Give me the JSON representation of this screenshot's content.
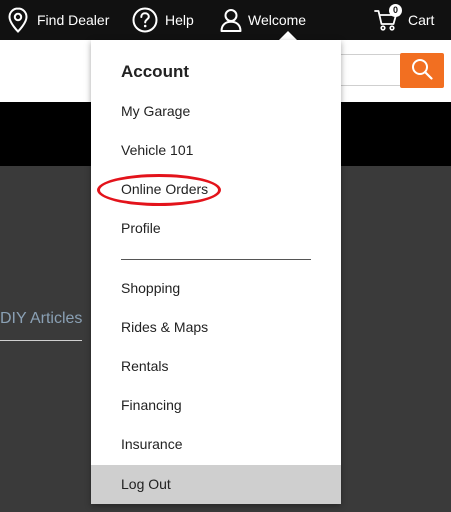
{
  "topbar": {
    "find_dealer": "Find Dealer",
    "help": "Help",
    "welcome": "Welcome",
    "cart": "Cart",
    "cart_count": "0"
  },
  "search": {
    "value": "",
    "placeholder": ""
  },
  "page": {
    "diy_articles": "DIY Articles"
  },
  "account_menu": {
    "title": "Account",
    "items_top": [
      "My Garage",
      "Vehicle 101",
      "Online Orders",
      "Profile"
    ],
    "items_bottom": [
      "Shopping",
      "Rides & Maps",
      "Rentals",
      "Financing",
      "Insurance"
    ],
    "logout": "Log Out",
    "highlighted_item": "Online Orders"
  },
  "colors": {
    "topbar_bg": "#111111",
    "accent_orange": "#f26f21",
    "highlight_red": "#e3131b",
    "logout_bg": "#cfcfcf",
    "page_bg": "#3a3a3a"
  },
  "icons": {
    "find_dealer": "location-pin-icon",
    "help": "question-circle-icon",
    "welcome": "user-icon",
    "cart": "shopping-cart-icon",
    "search": "magnifier-icon"
  }
}
